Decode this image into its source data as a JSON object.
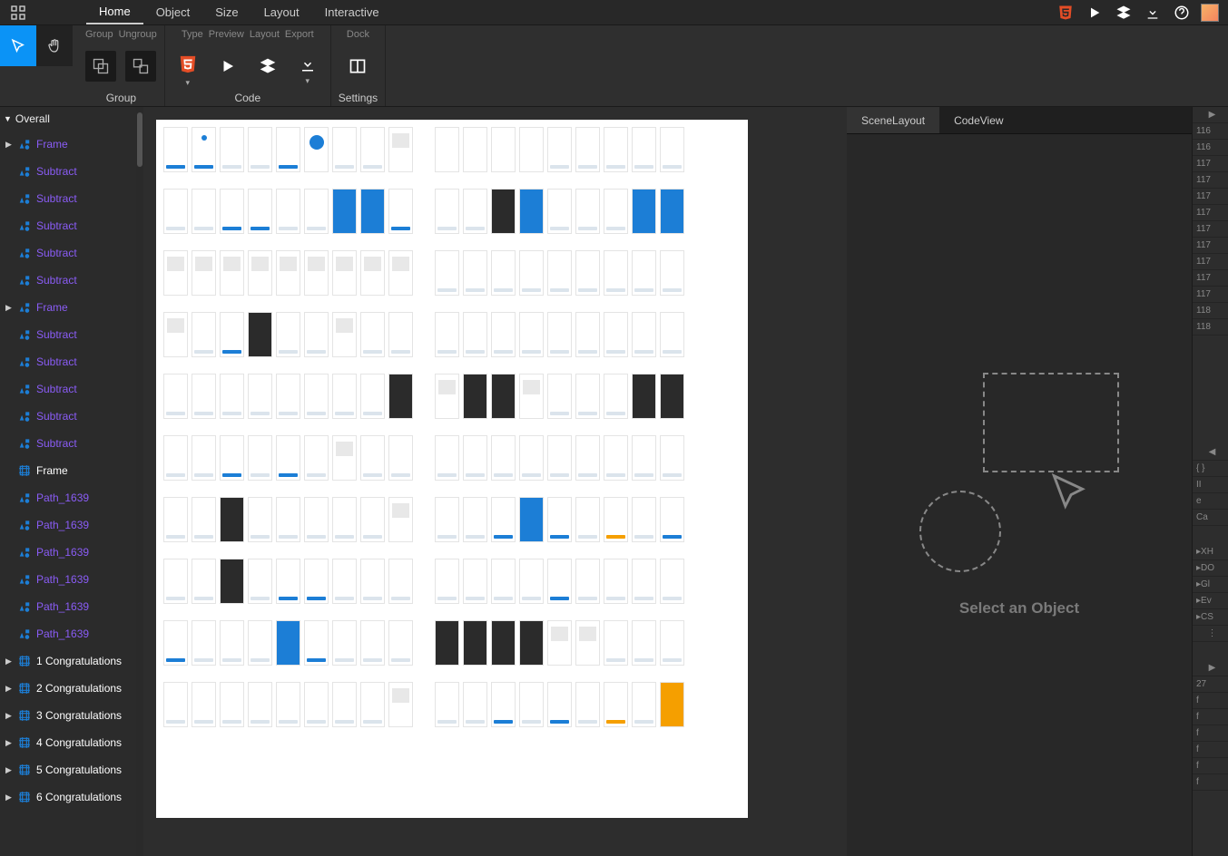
{
  "mainTabs": [
    "Home",
    "Object",
    "Size",
    "Layout",
    "Interactive"
  ],
  "activeMainTab": 0,
  "ribbon": {
    "group": {
      "subLabels": [
        "Group",
        "Ungroup"
      ],
      "caption": "Group"
    },
    "code": {
      "subLabels": [
        "Type",
        "Preview",
        "Layout",
        "Export"
      ],
      "caption": "Code"
    },
    "settings": {
      "subLabels": [
        "Dock"
      ],
      "caption": "Settings"
    }
  },
  "hierarchyHeader": "Overall",
  "layers": [
    {
      "label": "Frame",
      "type": "shape",
      "exp": true,
      "color": "purple"
    },
    {
      "label": "Subtract",
      "type": "shape",
      "color": "purple"
    },
    {
      "label": "Subtract",
      "type": "shape",
      "color": "purple"
    },
    {
      "label": "Subtract",
      "type": "shape",
      "color": "purple"
    },
    {
      "label": "Subtract",
      "type": "shape",
      "color": "purple"
    },
    {
      "label": "Subtract",
      "type": "shape",
      "color": "purple"
    },
    {
      "label": "Frame",
      "type": "shape",
      "exp": true,
      "color": "purple"
    },
    {
      "label": "Subtract",
      "type": "shape",
      "color": "purple"
    },
    {
      "label": "Subtract",
      "type": "shape",
      "color": "purple"
    },
    {
      "label": "Subtract",
      "type": "shape",
      "color": "purple"
    },
    {
      "label": "Subtract",
      "type": "shape",
      "color": "purple"
    },
    {
      "label": "Subtract",
      "type": "shape",
      "color": "purple"
    },
    {
      "label": "Frame",
      "type": "frame",
      "color": "white"
    },
    {
      "label": "Path_1639",
      "type": "shape",
      "color": "purple"
    },
    {
      "label": "Path_1639",
      "type": "shape",
      "color": "purple"
    },
    {
      "label": "Path_1639",
      "type": "shape",
      "color": "purple"
    },
    {
      "label": "Path_1639",
      "type": "shape",
      "color": "purple"
    },
    {
      "label": "Path_1639",
      "type": "shape",
      "color": "purple"
    },
    {
      "label": "Path_1639",
      "type": "shape",
      "color": "purple"
    },
    {
      "label": "1 Congratulations",
      "type": "frame",
      "exp": true,
      "color": "white"
    },
    {
      "label": "2 Congratulations",
      "type": "frame",
      "exp": true,
      "color": "white"
    },
    {
      "label": "3 Congratulations",
      "type": "frame",
      "exp": true,
      "color": "white"
    },
    {
      "label": "4 Congratulations",
      "type": "frame",
      "exp": true,
      "color": "white"
    },
    {
      "label": "5 Congratulations",
      "type": "frame",
      "exp": true,
      "color": "white"
    },
    {
      "label": "6 Congratulations",
      "type": "frame",
      "exp": true,
      "color": "white"
    }
  ],
  "rightTabs": [
    "SceneLayout",
    "CodeView"
  ],
  "activeRightTab": 0,
  "placeholderText": "Select an Object",
  "gutterTop": [
    "116",
    "116",
    "117",
    "117",
    "117",
    "117",
    "117",
    "117",
    "117",
    "117",
    "117",
    "118",
    "118"
  ],
  "gutterMid": [
    "{ }",
    "II",
    "e",
    "Ca"
  ],
  "gutterProps": [
    "XH",
    "DO",
    "Gl",
    "Ev",
    "CS"
  ],
  "gutterBottom": [
    "27",
    "f",
    "f",
    "f",
    "f",
    "f",
    "f"
  ]
}
